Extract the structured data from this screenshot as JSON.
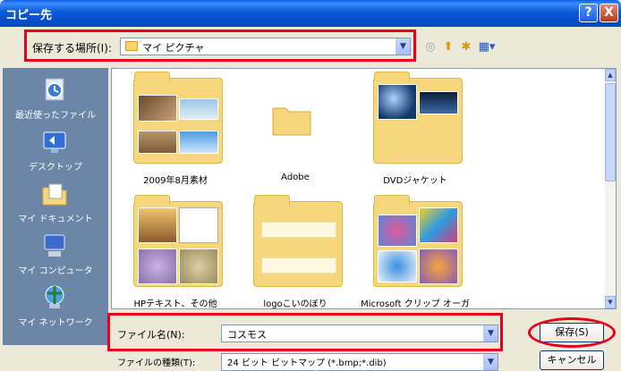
{
  "window": {
    "title": "コピー先"
  },
  "title_buttons": {
    "help": "?",
    "close": "X"
  },
  "location": {
    "label": "保存する場所(I):",
    "value": "マイ ピクチャ"
  },
  "toolbar": {
    "back_icon": "back-icon",
    "up_icon": "up-folder-icon",
    "new_folder_icon": "new-folder-icon",
    "view_icon": "view-menu-icon"
  },
  "places": [
    {
      "label": "最近使ったファイル",
      "icon": "recent-icon"
    },
    {
      "label": "デスクトップ",
      "icon": "desktop-icon"
    },
    {
      "label": "マイ ドキュメント",
      "icon": "my-documents-icon"
    },
    {
      "label": "マイ コンピュータ",
      "icon": "my-computer-icon"
    },
    {
      "label": "マイ ネットワーク",
      "icon": "my-network-icon"
    }
  ],
  "files": [
    {
      "name": "2009年8月素材"
    },
    {
      "name": "Adobe"
    },
    {
      "name": "DVDジャケット"
    },
    {
      "name": "HPテキスト、その他"
    },
    {
      "name": "logoこいのぼり"
    },
    {
      "name": "Microsoft クリップ オーガ"
    }
  ],
  "filename": {
    "label": "ファイル名(N):",
    "value": "コスモス"
  },
  "filetype": {
    "label": "ファイルの種類(T):",
    "value": "24 ビット ビットマップ (*.bmp;*.dib)"
  },
  "buttons": {
    "save": "保存(S)",
    "cancel": "キャンセル"
  },
  "highlight_color": "#e8001c",
  "titlebar_color": "#0b5ad8"
}
